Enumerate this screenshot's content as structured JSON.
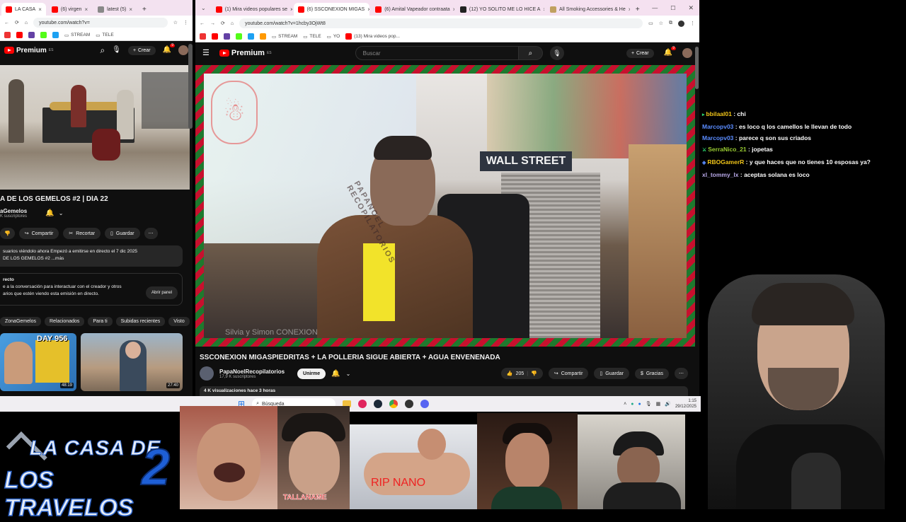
{
  "left_browser": {
    "tabs": [
      {
        "label": "LA CASA",
        "active": true
      },
      {
        "label": "(6) virgen",
        "active": false
      },
      {
        "label": "latest (5)",
        "active": false
      }
    ],
    "url": "youtube.com/watch?v=",
    "bookmarks": [
      "STREAM",
      "TELE"
    ],
    "logo_text": "Premium",
    "logo_region": "ES",
    "create_label": "Crear",
    "notif_count": "9",
    "video_title": "A DE LOS GEMELOS #2 | DÍA 22",
    "channel_name": "aGemelos",
    "subscribers": "K suscriptores",
    "actions": {
      "share": "Compartir",
      "clip": "Recortar",
      "save": "Guardar"
    },
    "desc_line1": "suarios viéndolo ahora  Empezó a emitirse en directo el 7 dic 2025",
    "desc_line2": "DE LOS GEMELOS #2 ...más",
    "chat_heading": "recto",
    "chat_text1": "e a la conversación para interactuar con el creador y otros",
    "chat_text2": "arios que estén viendo esta emisión en directo.",
    "chat_button": "Abrir panel",
    "chips": [
      "ZonaGemelos",
      "Relacionados",
      "Para ti",
      "Subidas recientes",
      "Visto"
    ],
    "thumbs": [
      {
        "overlay": "DAY 956",
        "duration": "48:19"
      },
      {
        "overlay": "",
        "duration": "27:40"
      }
    ]
  },
  "right_browser": {
    "tabs": [
      {
        "label": "(1) Mira videos populares se",
        "active": false
      },
      {
        "label": "(6) SSCONEXION MIGAS",
        "active": true
      },
      {
        "label": "(6) Amital Vapeador contraata",
        "active": false
      },
      {
        "label": "(12) YO SOLITO ME LO HICE A",
        "active": false
      },
      {
        "label": "All Smoking Accessories & He",
        "active": false
      }
    ],
    "url": "youtube.com/watch?v=1hcby3OjWt8",
    "bookmarks": [
      "STREAM",
      "TELE",
      "YO",
      "(13) Mira videos pop..."
    ],
    "logo_text": "Premium",
    "logo_region": "ES",
    "search_placeholder": "Buscar",
    "create_label": "Crear",
    "notif_count": "9",
    "video": {
      "watermark": "PAPANOEL RECOPILATORIOS",
      "sign": "WALL STREET",
      "caption": "Silvia y Simon CONEXION"
    },
    "video_title": "SSCONEXION MIGASPIEDRITAS + LA POLLERIA SIGUE ABIERTA + AGUA ENVENENADA",
    "channel_name": "PapaNoelRecopilatorios",
    "subscribers": "17,9 K suscriptores",
    "join_label": "Unirme",
    "likes": "205",
    "actions": {
      "share": "Compartir",
      "save": "Guardar",
      "thanks": "Gracias"
    },
    "views": "4 K visualizaciones  hace 3 horas"
  },
  "taskbar": {
    "search_label": "Búsqueda",
    "time": "1:15",
    "date": "29/12/2025"
  },
  "chat": [
    {
      "user": "bbilaal01",
      "color": "#f0c419",
      "msg": "chi"
    },
    {
      "user": "Marcopv03",
      "color": "#5a8cff",
      "msg": "es loco q los camellos le llevan de todo"
    },
    {
      "user": "Marcopv03",
      "color": "#5a8cff",
      "msg": "parece q son sus criados"
    },
    {
      "user": "SerraNico_21",
      "color": "#9acd32",
      "msg": "jopetas"
    },
    {
      "user": "RBOGamerR",
      "color": "#f0c419",
      "msg": "y que haces que no tienes 10 esposas ya?"
    },
    {
      "user": "xl_tommy_lx",
      "color": "#b8a8e8",
      "msg": "aceptas solana es loco"
    }
  ],
  "overlay": {
    "logo_line1": "LA CASA DE",
    "logo_line2": "LOS TRAVELOS",
    "logo_number": "2",
    "strip_captions": [
      "TALLANAME",
      "RIP NANO"
    ]
  }
}
